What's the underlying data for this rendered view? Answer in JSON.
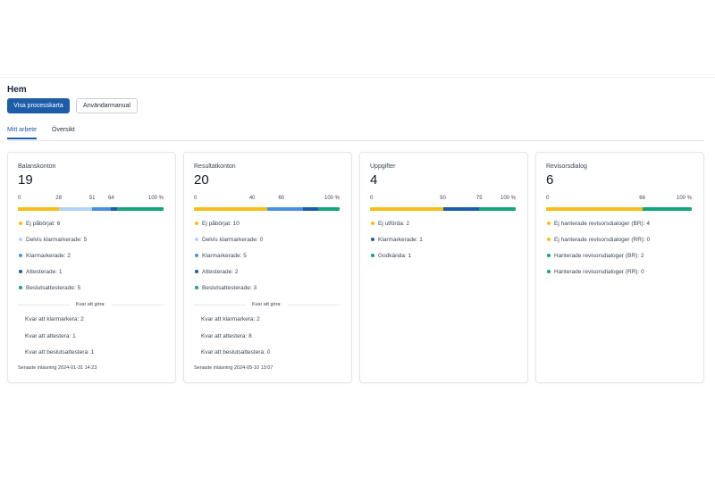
{
  "page": {
    "title": "Hem"
  },
  "buttons": {
    "process_map": "Visa processkarta",
    "manual": "Användarmanual"
  },
  "tabs": [
    {
      "label": "Mitt arbete",
      "active": true
    },
    {
      "label": "Översikt",
      "active": false
    }
  ],
  "colors": {
    "yellow": "#f5be1b",
    "light_blue": "#b3d3f5",
    "mid_blue": "#4a90e2",
    "dark_blue": "#1d5ca8",
    "green": "#14a37f",
    "primary": "#1d5ca8"
  },
  "cards": [
    {
      "title": "Balanskonton",
      "count": "19",
      "ticks": [
        "0",
        "28",
        "51",
        "64",
        "100 %"
      ],
      "progress": {
        "segments": [
          {
            "color": "#f5be1b",
            "percent": 28
          },
          {
            "color": "#b3d3f5",
            "percent": 23
          },
          {
            "color": "#4a90e2",
            "percent": 13
          },
          {
            "color": "#1d5ca8",
            "percent": 4
          },
          {
            "color": "#14a37f",
            "percent": 32
          }
        ]
      },
      "legend": [
        {
          "label": "Ej påbörjat: 6",
          "color": "#f5be1b"
        },
        {
          "label": "Delvis klarmarkerade: 5",
          "color": "#b3d3f5"
        },
        {
          "label": "Klarmarkerade: 2",
          "color": "#4a90e2"
        },
        {
          "label": "Attesterade: 1",
          "color": "#1d5ca8"
        },
        {
          "label": "Beslutsattesterade: 5",
          "color": "#14a37f"
        }
      ],
      "todo_header": "Kvar att göra:",
      "todos": [
        "Kvar att klarmarkera: 2",
        "Kvar att attestera: 1",
        "Kvar att beslutsattestera: 1"
      ],
      "last_import": "Senaste inläsning 2024-01-31 14:23"
    },
    {
      "title": "Resultatkonton",
      "count": "20",
      "ticks": [
        "0",
        "40",
        "60",
        "100 %"
      ],
      "progress": {
        "segments": [
          {
            "color": "#f5be1b",
            "percent": 50
          },
          {
            "color": "#4a90e2",
            "percent": 25
          },
          {
            "color": "#1d5ca8",
            "percent": 10
          },
          {
            "color": "#14a37f",
            "percent": 15
          }
        ]
      },
      "legend": [
        {
          "label": "Ej påbörjat: 10",
          "color": "#f5be1b"
        },
        {
          "label": "Delvis klarmarkerade: 0",
          "color": "#b3d3f5"
        },
        {
          "label": "Klarmarkerade: 5",
          "color": "#4a90e2"
        },
        {
          "label": "Attesterade: 2",
          "color": "#1d5ca8"
        },
        {
          "label": "Beslutsattesterade: 3",
          "color": "#14a37f"
        }
      ],
      "todo_header": "Kvar att göra:",
      "todos": [
        "Kvar att klarmarkera: 2",
        "Kvar att attestera: 8",
        "Kvar att beslutsattestera: 0"
      ],
      "last_import": "Senaste inläsning 2024-05-10 13:07"
    },
    {
      "title": "Uppgifter",
      "count": "4",
      "ticks": [
        "0",
        "50",
        "75",
        "100 %"
      ],
      "progress": {
        "segments": [
          {
            "color": "#f5be1b",
            "percent": 50
          },
          {
            "color": "#1d5ca8",
            "percent": 25
          },
          {
            "color": "#14a37f",
            "percent": 25
          }
        ]
      },
      "legend": [
        {
          "label": "Ej utförda: 2",
          "color": "#f5be1b"
        },
        {
          "label": "Klarmarkerade: 1",
          "color": "#1d5ca8"
        },
        {
          "label": "Godkända: 1",
          "color": "#14a37f"
        }
      ]
    },
    {
      "title": "Revisorsdialog",
      "count": "6",
      "ticks": [
        "0",
        "66",
        "100 %"
      ],
      "progress": {
        "segments": [
          {
            "color": "#f5be1b",
            "percent": 66
          },
          {
            "color": "#14a37f",
            "percent": 34
          }
        ]
      },
      "legend": [
        {
          "label": "Ej hanterade revisorsdialoger (BR): 4",
          "color": "#f5be1b"
        },
        {
          "label": "Ej hanterade revisorsdialoger (RR): 0",
          "color": "#f5be1b"
        },
        {
          "label": "Hanterade revisorsdialoger (BR): 2",
          "color": "#14a37f"
        },
        {
          "label": "Hanterade revisorsdialoger (RR): 0",
          "color": "#14a37f"
        }
      ]
    }
  ]
}
